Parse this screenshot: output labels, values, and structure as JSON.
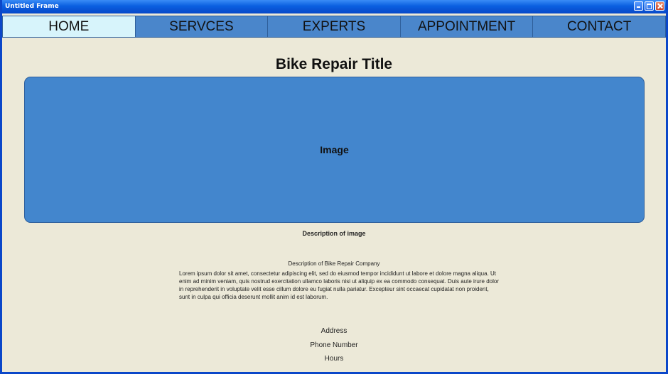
{
  "window": {
    "title": "Untitled Frame"
  },
  "nav": {
    "items": [
      {
        "label": "HOME",
        "active": true
      },
      {
        "label": "SERVCES",
        "active": false
      },
      {
        "label": "EXPERTS",
        "active": false
      },
      {
        "label": "APPOINTMENT",
        "active": false
      },
      {
        "label": "CONTACT",
        "active": false
      }
    ]
  },
  "main": {
    "title": "Bike Repair Title",
    "image_placeholder": "Image",
    "image_caption": "Description of image",
    "company_heading": "Description of Bike Repair Company",
    "company_body": "Lorem ipsum dolor sit amet, consectetur adipiscing elit, sed do eiusmod tempor incididunt ut labore et dolore magna aliqua. Ut enim ad minim veniam, quis nostrud exercitation ullamco laboris nisi ut aliquip ex ea commodo consequat. Duis aute irure dolor in reprehenderit in voluptate velit esse cillum dolore eu fugiat nulla pariatur. Excepteur sint occaecat cupidatat non proident, sunt in culpa qui officia deserunt mollit anim id est laborum."
  },
  "contact": {
    "address": "Address",
    "phone": "Phone Number",
    "hours": "Hours"
  },
  "colors": {
    "nav_active": "#d7f4fb",
    "nav_default": "#4a86cb",
    "hero": "#4386cd",
    "background": "#ece9d8"
  },
  "icons": {
    "window_buttons": [
      "minimize-icon",
      "maximize-icon",
      "close-icon"
    ]
  }
}
